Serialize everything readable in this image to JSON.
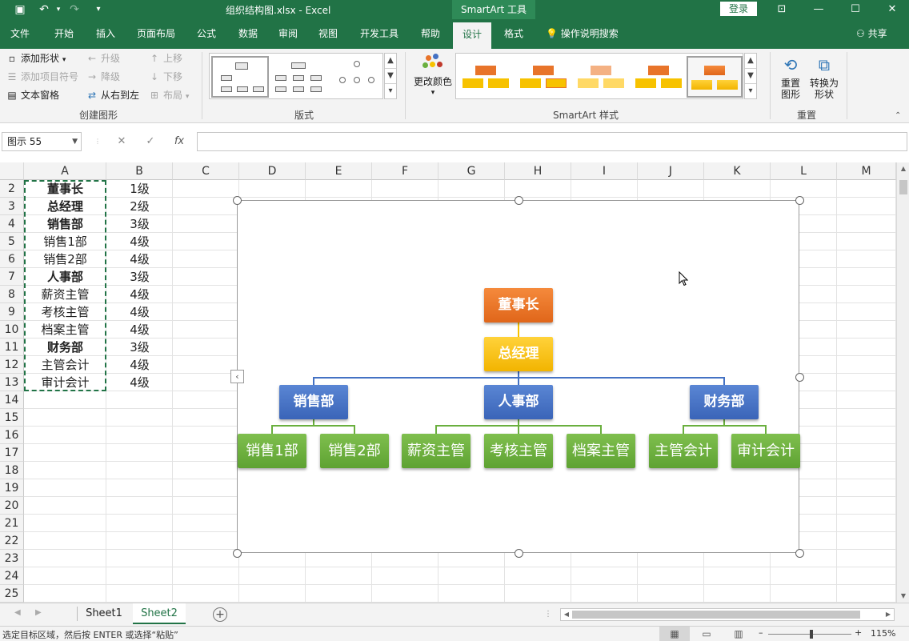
{
  "titlebar": {
    "title": "组织结构图.xlsx  -  Excel",
    "contextual_tab": "SmartArt 工具",
    "login": "登录",
    "undo_arrow": "▾"
  },
  "tabs": {
    "items": [
      "文件",
      "开始",
      "插入",
      "页面布局",
      "公式",
      "数据",
      "审阅",
      "视图",
      "开发工具",
      "帮助",
      "设计",
      "格式"
    ],
    "active": "设计",
    "search": "操作说明搜索",
    "share": "共享"
  },
  "ribbon": {
    "create_graphic": {
      "label": "创建图形",
      "add_shape": "添加形状",
      "add_bullet": "添加项目符号",
      "text_pane": "文本窗格",
      "promote": "升级",
      "demote": "降级",
      "right_to_left": "从右到左",
      "move_up": "上移",
      "move_down": "下移",
      "layout": "布局"
    },
    "layouts": {
      "label": "版式"
    },
    "styles": {
      "label": "SmartArt 样式",
      "change_colors": "更改颜色"
    },
    "reset": {
      "label": "重置",
      "reset_graphic": "重置\n图形",
      "convert_shape": "转换为\n形状"
    }
  },
  "formula_bar": {
    "name_box": "图示 55",
    "cancel": "✕",
    "enter": "✓",
    "fx": "fx",
    "value": ""
  },
  "grid": {
    "columns": [
      "A",
      "B",
      "C",
      "D",
      "E",
      "F",
      "G",
      "H",
      "I",
      "J",
      "K",
      "L",
      "M"
    ],
    "rows": [
      "2",
      "3",
      "4",
      "5",
      "6",
      "7",
      "8",
      "9",
      "10",
      "11",
      "12",
      "13",
      "14",
      "15",
      "16",
      "17",
      "18",
      "19",
      "20",
      "21",
      "22",
      "23",
      "24",
      "25"
    ],
    "data": [
      {
        "a": "董事长",
        "b": "1级",
        "bold": true
      },
      {
        "a": "总经理",
        "b": "2级",
        "bold": true
      },
      {
        "a": "销售部",
        "b": "3级",
        "bold": true
      },
      {
        "a": "销售1部",
        "b": "4级",
        "bold": false
      },
      {
        "a": "销售2部",
        "b": "4级",
        "bold": false
      },
      {
        "a": "人事部",
        "b": "3级",
        "bold": true
      },
      {
        "a": "薪资主管",
        "b": "4级",
        "bold": false
      },
      {
        "a": "考核主管",
        "b": "4级",
        "bold": false
      },
      {
        "a": "档案主管",
        "b": "4级",
        "bold": false
      },
      {
        "a": "财务部",
        "b": "3级",
        "bold": true
      },
      {
        "a": "主管会计",
        "b": "4级",
        "bold": false
      },
      {
        "a": "审计会计",
        "b": "4级",
        "bold": false
      }
    ]
  },
  "smartart": {
    "level1": "董事长",
    "level2": "总经理",
    "departments": [
      {
        "name": "销售部",
        "children": [
          "销售1部",
          "销售2部"
        ]
      },
      {
        "name": "人事部",
        "children": [
          "薪资主管",
          "考核主管",
          "档案主管"
        ]
      },
      {
        "name": "财务部",
        "children": [
          "主管会计",
          "审计会计"
        ]
      }
    ],
    "colors": {
      "level1": "#e8742a",
      "level2": "#f7c200",
      "level3": "#4472c4",
      "level4": "#6aaf3e",
      "connector_blue": "#4472c4",
      "connector_green": "#6aaf3e",
      "connector_yellow": "#f7c200"
    }
  },
  "sheets": {
    "tabs": [
      "Sheet1",
      "Sheet2"
    ],
    "active": "Sheet2"
  },
  "status": {
    "message": "选定目标区域，然后按 ENTER 或选择“粘贴”",
    "zoom": "115%",
    "minus": "–",
    "plus": "+"
  },
  "accent_color": "#217346"
}
